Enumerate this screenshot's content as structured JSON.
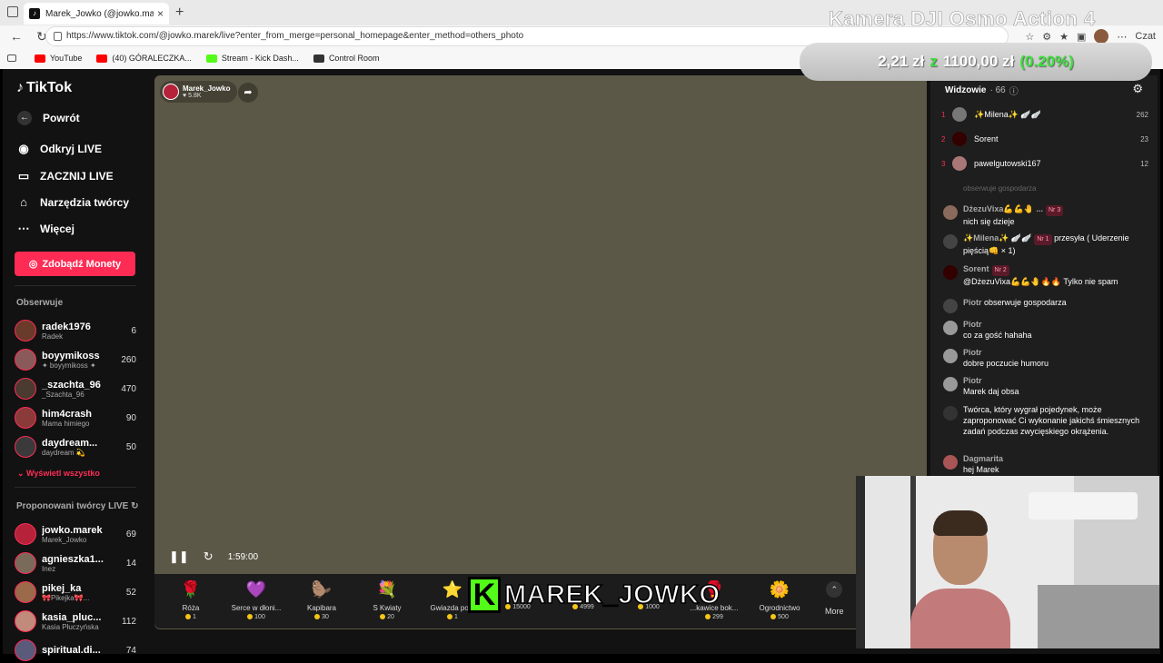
{
  "browser": {
    "tab_title": "Marek_Jowko (@jowko.marek) pro",
    "url": "https://www.tiktok.com/@jowko.marek/live?enter_from_merge=personal_homepage&enter_method=others_photo",
    "copilot_label": "Czat",
    "bookmarks": [
      {
        "label": "YouTube",
        "color": "#ff0000"
      },
      {
        "label": "(40) GÓRALECZKA...",
        "color": "#ff0000"
      },
      {
        "label": "Stream - Kick Dash...",
        "color": "#53fc18"
      },
      {
        "label": "Control Room",
        "color": "#333333"
      }
    ]
  },
  "overlay": {
    "title": "Kamera DJI Osmo Action 4",
    "price_from": "2,21 zł",
    "price_sep": "z",
    "price_to": "1100,00 zł",
    "price_pct": "(0.20%)",
    "name_k": "K",
    "streamer_name": "MAREK_JOWKO"
  },
  "sidebar": {
    "logo": "TikTok",
    "back": "Powrót",
    "menu": [
      {
        "label": "Odkryj LIVE",
        "icon": "live-icon"
      },
      {
        "label": "ZACZNIJ LIVE",
        "icon": "camera-icon"
      },
      {
        "label": "Narzędzia twórcy",
        "icon": "home-icon"
      },
      {
        "label": "Więcej",
        "icon": "dots-icon"
      }
    ],
    "coins_button": "Zdobądź Monety",
    "following_title": "Obserwuje",
    "following": [
      {
        "name": "radek1976",
        "sub": "Radek",
        "count": "6",
        "color": "#6a3b2a"
      },
      {
        "name": "boyymikoss",
        "sub": "✦ boyymikoss ✦",
        "count": "260",
        "color": "#8a5a5a"
      },
      {
        "name": "_szachta_96",
        "sub": "_Szachta_96",
        "count": "470",
        "color": "#4a3a30"
      },
      {
        "name": "him4crash",
        "sub": "Mama himiego",
        "count": "90",
        "color": "#8b3a3a"
      },
      {
        "name": "daydream...",
        "sub": "daydream 💫",
        "count": "50",
        "color": "#3a3a3a"
      }
    ],
    "show_all": "Wyświetl wszystko",
    "suggested_title": "Proponowani twórcy LIVE",
    "suggested": [
      {
        "name": "jowko.marek",
        "sub": "Marek_Jowko",
        "count": "69",
        "color": "#b5223a"
      },
      {
        "name": "agnieszka1...",
        "sub": "Inez",
        "count": "14",
        "color": "#7a6a5a"
      },
      {
        "name": "pikej_ka",
        "sub": "🎀Pikejka🎀...",
        "count": "52",
        "color": "#9a6a4a"
      },
      {
        "name": "kasia_pluc...",
        "sub": "Kasia Płuczyńska",
        "count": "112",
        "color": "#c28a7a"
      },
      {
        "name": "spiritual.di...",
        "sub": "",
        "count": "74",
        "color": "#5a5a7a"
      }
    ]
  },
  "video": {
    "host_name": "Marek_Jowko",
    "host_likes": "♥ 5.8K",
    "time": "1:59:00",
    "bg_color": "#5c5847"
  },
  "gifts": [
    {
      "name": "Róża",
      "cost": "1",
      "icon": "🌹"
    },
    {
      "name": "Serce w dłoni...",
      "cost": "100",
      "icon": "💜"
    },
    {
      "name": "Kapibara",
      "cost": "30",
      "icon": "🦫"
    },
    {
      "name": "S Kwiaty",
      "cost": "20",
      "icon": "💐"
    },
    {
      "name": "Gwiazda po...",
      "cost": "1",
      "icon": "⭐"
    },
    {
      "name": "",
      "cost": "15000",
      "icon": ""
    },
    {
      "name": "",
      "cost": "4999",
      "icon": ""
    },
    {
      "name": "",
      "cost": "1000",
      "icon": ""
    },
    {
      "name": "...kawice bok...",
      "cost": "299",
      "icon": "🥊"
    },
    {
      "name": "Ogrodnictwo",
      "cost": "500",
      "icon": "🌼"
    }
  ],
  "more_label": "More",
  "chat": {
    "viewers_label": "Widzowie",
    "viewers_count": "· 66",
    "top": [
      {
        "rank": "1",
        "name": "✨Milena✨ 🪽🪽",
        "count": "262",
        "color": "#777"
      },
      {
        "rank": "2",
        "name": "Sorent",
        "count": "23",
        "color": "#300"
      },
      {
        "rank": "3",
        "name": "pawelgutowski167",
        "count": "12",
        "color": "#a77"
      }
    ],
    "faded": "obserwuje gospodarza",
    "messages": [
      {
        "name": "DżezuVixa💪💪🤚 ...",
        "badge": "Nr 3",
        "text": "nich się dzieje",
        "color": "#8a6a5a"
      },
      {
        "name": "✨Milena✨ 🪽🪽",
        "badge": "Nr 1",
        "text": "przesyła ( Uderzenie pięścią👊 × 1)",
        "color": "#444"
      },
      {
        "name": "Sorent",
        "badge": "Nr 2",
        "text": "@DżezuVixa💪💪🤚🔥🔥 Tylko nie spam",
        "color": "#300"
      },
      {
        "name": "Piotr",
        "badge": "",
        "text": "obserwuje gospodarza",
        "color": "#444"
      },
      {
        "name": "Piotr",
        "badge": "",
        "text": "co za gość hahaha",
        "color": "#999"
      },
      {
        "name": "Piotr",
        "badge": "",
        "text": "dobre poczucie humoru",
        "color": "#999"
      },
      {
        "name": "Piotr",
        "badge": "",
        "text": "Marek daj obsa",
        "color": "#999"
      },
      {
        "name": "",
        "badge": "",
        "text": "Twórca, który wygrał pojedynek, może zaproponować Ci wykonanie jakichś śmiesznych zadań podczas zwycięskiego okrążenia.",
        "color": "#333"
      },
      {
        "name": "Dagmarita",
        "badge": "",
        "text": "hej Marek",
        "color": "#a55"
      }
    ]
  }
}
